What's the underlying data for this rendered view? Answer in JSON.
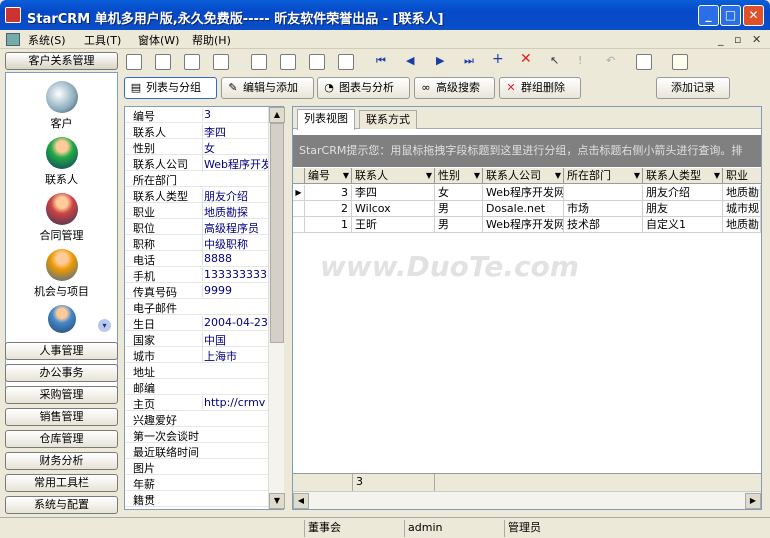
{
  "window": {
    "title": "StarCRM 单机多用户版,永久免费版----- 昕友软件荣誉出品  - [联系人]",
    "min": "_",
    "max": "□",
    "close": "✕"
  },
  "menu": {
    "items": [
      "系统(S)",
      "工具(T)",
      "窗体(W)",
      "帮助(H)"
    ],
    "mdi": [
      "_",
      "▫",
      "✕"
    ]
  },
  "sidebar": {
    "main_label": "客户关系管理",
    "nav": [
      {
        "label": "客户",
        "icon": "magnifier-icon"
      },
      {
        "label": "联系人",
        "icon": "person-icon"
      },
      {
        "label": "合同管理",
        "icon": "contract-icon"
      },
      {
        "label": "机会与项目",
        "icon": "opportunity-icon"
      }
    ],
    "sections": [
      "人事管理",
      "办公事务",
      "采购管理",
      "销售管理",
      "仓库管理",
      "财务分析",
      "常用工具栏",
      "系统与配置"
    ]
  },
  "toolbar2": {
    "group_label": "列表与分组",
    "edit_label": "编辑与添加",
    "chart_label": "图表与分析",
    "search_label": "高级搜索",
    "delete_label": "群组删除",
    "add_label": "添加记录"
  },
  "props": {
    "rows": [
      {
        "k": "编号",
        "v": "3"
      },
      {
        "k": "联系人",
        "v": "李四"
      },
      {
        "k": "性别",
        "v": "女"
      },
      {
        "k": "联系人公司",
        "v": "Web程序开发"
      },
      {
        "k": "所在部门",
        "v": ""
      },
      {
        "k": "联系人类型",
        "v": "朋友介绍"
      },
      {
        "k": "职业",
        "v": "地质勘探"
      },
      {
        "k": "职位",
        "v": "高级程序员"
      },
      {
        "k": "职称",
        "v": "中级职称"
      },
      {
        "k": "电话",
        "v": "8888"
      },
      {
        "k": "手机",
        "v": "133333333"
      },
      {
        "k": "传真号码",
        "v": "9999"
      },
      {
        "k": "电子邮件",
        "v": ""
      },
      {
        "k": "生日",
        "v": "2004-04-23"
      },
      {
        "k": "国家",
        "v": "中国"
      },
      {
        "k": "城市",
        "v": "上海市"
      },
      {
        "k": "地址",
        "v": ""
      },
      {
        "k": "邮编",
        "v": ""
      },
      {
        "k": "主页",
        "v": "http://crmv"
      },
      {
        "k": "兴趣爱好",
        "v": ""
      },
      {
        "k": "第一次会谈时",
        "v": ""
      },
      {
        "k": "最近联络时间",
        "v": ""
      },
      {
        "k": "图片",
        "v": ""
      },
      {
        "k": "年薪",
        "v": ""
      },
      {
        "k": "籍贯",
        "v": ""
      }
    ]
  },
  "grid": {
    "tabs": [
      "列表视图",
      "联系方式"
    ],
    "hint": "StarCRM提示您：用鼠标拖拽字段标题到这里进行分组，点击标题右侧小箭头进行查询。排",
    "columns": [
      "编号",
      "联系人",
      "性别",
      "联系人公司",
      "所在部门",
      "联系人类型",
      "职业"
    ],
    "rows": [
      [
        "3",
        "李四",
        "女",
        "Web程序开发网",
        "",
        "朋友介绍",
        "地质勘"
      ],
      [
        "2",
        "Wilcox",
        "男",
        "Dosale.net",
        "市场",
        "朋友",
        "城市规"
      ],
      [
        "1",
        "王昕",
        "男",
        "Web程序开发网",
        "技术部",
        "自定义1",
        "地质勘"
      ]
    ],
    "footer_count": "3"
  },
  "status": {
    "dept": "董事会",
    "user": "admin",
    "role": "管理员"
  },
  "watermark": "www.DuoTe.com"
}
